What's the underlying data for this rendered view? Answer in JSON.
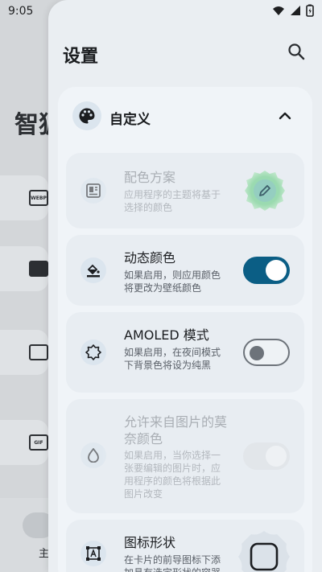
{
  "status_bar": {
    "time": "9:05"
  },
  "background_app": {
    "title_partial": "智狐",
    "icon_labels": [
      "WEBP",
      "",
      "",
      "GIF"
    ],
    "nav_label_partial": "主"
  },
  "header": {
    "title": "设置"
  },
  "section": {
    "label": "自定义"
  },
  "items": [
    {
      "name": "配色方案",
      "desc": "应用程序的主题将基于选择的颜色",
      "enabled": false
    },
    {
      "name": "动态颜色",
      "desc": "如果启用，则应用颜色将更改为壁纸颜色",
      "toggle": true
    },
    {
      "name": "AMOLED 模式",
      "desc": "如果启用，在夜间模式下背景色将设为纯黑",
      "toggle": false
    },
    {
      "name": "允许来自图片的莫奈颜色",
      "desc": "如果启用，当你选择一张要编辑的图片时，应用程序的颜色将根据此图片改变",
      "toggle": true,
      "enabled": false
    },
    {
      "name": "图标形状",
      "desc": "在卡片的前导图标下添加具有选定形状的容器"
    }
  ],
  "colors": {
    "accent": "#0b5e85",
    "surface": "#eaeef2",
    "card": "#e8edf2"
  }
}
